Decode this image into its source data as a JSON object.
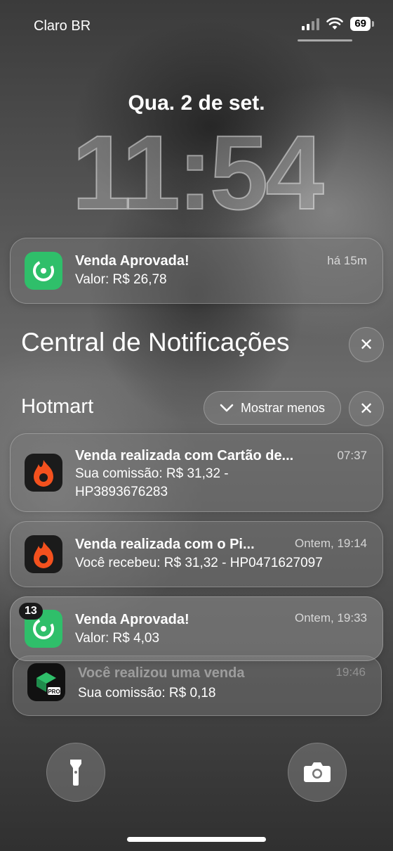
{
  "status_bar": {
    "carrier": "Claro BR",
    "battery": "69"
  },
  "lock": {
    "date": "Qua. 2 de set.",
    "time": "11:54"
  },
  "top_notification": {
    "title": "Venda Aprovada!",
    "body": "Valor: R$ 26,78",
    "time": "há 15m"
  },
  "notification_center": {
    "title": "Central de Notificações",
    "close_label": "✕"
  },
  "group": {
    "app_name": "Hotmart",
    "show_less_label": "Mostrar menos",
    "close_label": "✕",
    "items": [
      {
        "title": "Venda realizada com Cartão de...",
        "body": "Sua comissão: R$ 31,32 -",
        "body2": "HP3893676283",
        "time": "07:37"
      },
      {
        "title": "Venda realizada com o Pi...",
        "body": "Você recebeu: R$ 31,32 - HP0471627097",
        "time": "Ontem, 19:14"
      }
    ]
  },
  "stack": {
    "front": {
      "title": "Venda Aprovada!",
      "body": "Valor: R$ 4,03",
      "time": "Ontem, 19:33",
      "badge": "13"
    },
    "back": {
      "title": "Você realizou uma venda",
      "body": "Sua comissão: R$ 0,18",
      "time": "19:46",
      "icon_label": "PRO"
    }
  },
  "colors": {
    "accent_green": "#2fbf6a",
    "hotmart_orange": "#f4511e"
  }
}
